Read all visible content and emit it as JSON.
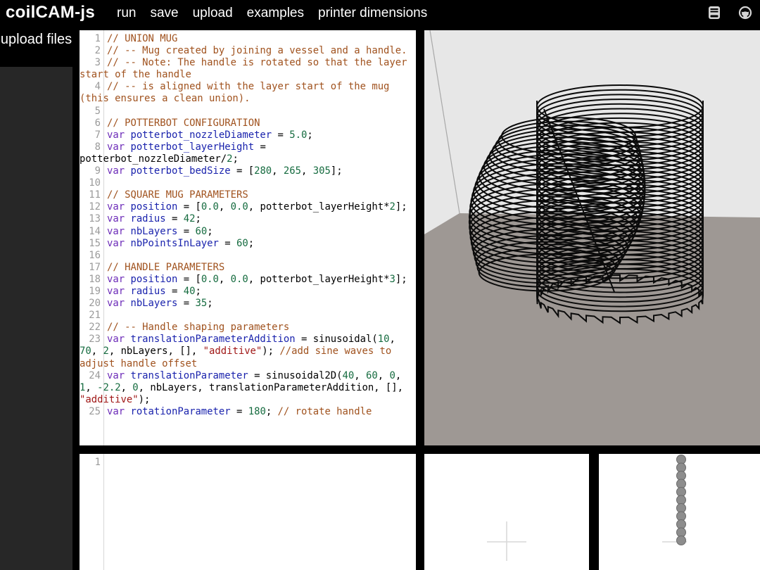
{
  "app": {
    "title": "coilCAM-js"
  },
  "nav": {
    "items": [
      "run",
      "save",
      "upload",
      "examples",
      "printer dimensions"
    ]
  },
  "icons": {
    "docs": "book-icon",
    "github": "github-icon"
  },
  "sidebar": {
    "upload_label": "upload files"
  },
  "editor": {
    "lines": [
      {
        "n": "1",
        "segs": [
          {
            "t": "// UNION MUG",
            "c": "cm"
          }
        ]
      },
      {
        "n": "2",
        "segs": [
          {
            "t": "// -- Mug created by joining a vessel and a handle.",
            "c": "cm"
          }
        ]
      },
      {
        "n": "3",
        "segs": [
          {
            "t": "// -- Note: The handle is rotated so that the layer start of the handle",
            "c": "cm"
          }
        ]
      },
      {
        "n": "4",
        "segs": [
          {
            "t": "// -- is aligned with the layer start of the mug (this ensures a clean union).",
            "c": "cm"
          }
        ]
      },
      {
        "n": "5",
        "segs": []
      },
      {
        "n": "6",
        "segs": [
          {
            "t": "// POTTERBOT CONFIGURATION",
            "c": "cm"
          }
        ]
      },
      {
        "n": "7",
        "segs": [
          {
            "t": "var ",
            "c": "kw"
          },
          {
            "t": "potterbot_nozzleDiameter",
            "c": "vn"
          },
          {
            "t": " = ",
            "c": ""
          },
          {
            "t": "5.0",
            "c": "nm"
          },
          {
            "t": ";",
            "c": ""
          }
        ]
      },
      {
        "n": "8",
        "segs": [
          {
            "t": "var ",
            "c": "kw"
          },
          {
            "t": "potterbot_layerHeight",
            "c": "vn"
          },
          {
            "t": " = potterbot_nozzleDiameter/",
            "c": ""
          },
          {
            "t": "2",
            "c": "nm"
          },
          {
            "t": ";",
            "c": ""
          }
        ]
      },
      {
        "n": "9",
        "segs": [
          {
            "t": "var ",
            "c": "kw"
          },
          {
            "t": "potterbot_bedSize",
            "c": "vn"
          },
          {
            "t": " = [",
            "c": ""
          },
          {
            "t": "280",
            "c": "nm"
          },
          {
            "t": ", ",
            "c": ""
          },
          {
            "t": "265",
            "c": "nm"
          },
          {
            "t": ", ",
            "c": ""
          },
          {
            "t": "305",
            "c": "nm"
          },
          {
            "t": "];",
            "c": ""
          }
        ]
      },
      {
        "n": "10",
        "segs": []
      },
      {
        "n": "11",
        "segs": [
          {
            "t": "// SQUARE MUG PARAMETERS",
            "c": "cm"
          }
        ]
      },
      {
        "n": "12",
        "segs": [
          {
            "t": "var ",
            "c": "kw"
          },
          {
            "t": "position",
            "c": "vn"
          },
          {
            "t": " = [",
            "c": ""
          },
          {
            "t": "0.0",
            "c": "nm"
          },
          {
            "t": ", ",
            "c": ""
          },
          {
            "t": "0.0",
            "c": "nm"
          },
          {
            "t": ", potterbot_layerHeight*",
            "c": ""
          },
          {
            "t": "2",
            "c": "nm"
          },
          {
            "t": "];",
            "c": ""
          }
        ]
      },
      {
        "n": "13",
        "segs": [
          {
            "t": "var ",
            "c": "kw"
          },
          {
            "t": "radius",
            "c": "vn"
          },
          {
            "t": " = ",
            "c": ""
          },
          {
            "t": "42",
            "c": "nm"
          },
          {
            "t": ";",
            "c": ""
          }
        ]
      },
      {
        "n": "14",
        "segs": [
          {
            "t": "var ",
            "c": "kw"
          },
          {
            "t": "nbLayers",
            "c": "vn"
          },
          {
            "t": " = ",
            "c": ""
          },
          {
            "t": "60",
            "c": "nm"
          },
          {
            "t": ";",
            "c": ""
          }
        ]
      },
      {
        "n": "15",
        "segs": [
          {
            "t": "var ",
            "c": "kw"
          },
          {
            "t": "nbPointsInLayer",
            "c": "vn"
          },
          {
            "t": " = ",
            "c": ""
          },
          {
            "t": "60",
            "c": "nm"
          },
          {
            "t": ";",
            "c": ""
          }
        ]
      },
      {
        "n": "16",
        "segs": []
      },
      {
        "n": "17",
        "segs": [
          {
            "t": "// HANDLE PARAMETERS",
            "c": "cm"
          }
        ]
      },
      {
        "n": "18",
        "segs": [
          {
            "t": "var ",
            "c": "kw"
          },
          {
            "t": "position",
            "c": "vn"
          },
          {
            "t": " = [",
            "c": ""
          },
          {
            "t": "0.0",
            "c": "nm"
          },
          {
            "t": ", ",
            "c": ""
          },
          {
            "t": "0.0",
            "c": "nm"
          },
          {
            "t": ", potterbot_layerHeight*",
            "c": ""
          },
          {
            "t": "3",
            "c": "nm"
          },
          {
            "t": "];",
            "c": ""
          }
        ]
      },
      {
        "n": "19",
        "segs": [
          {
            "t": "var ",
            "c": "kw"
          },
          {
            "t": "radius",
            "c": "vn"
          },
          {
            "t": " = ",
            "c": ""
          },
          {
            "t": "40",
            "c": "nm"
          },
          {
            "t": ";",
            "c": ""
          }
        ]
      },
      {
        "n": "20",
        "segs": [
          {
            "t": "var ",
            "c": "kw"
          },
          {
            "t": "nbLayers",
            "c": "vn"
          },
          {
            "t": " = ",
            "c": ""
          },
          {
            "t": "35",
            "c": "nm"
          },
          {
            "t": ";",
            "c": ""
          }
        ]
      },
      {
        "n": "21",
        "segs": []
      },
      {
        "n": "22",
        "segs": [
          {
            "t": "// -- Handle shaping parameters",
            "c": "cm"
          }
        ]
      },
      {
        "n": "23",
        "segs": [
          {
            "t": "var ",
            "c": "kw"
          },
          {
            "t": "translationParameterAddition",
            "c": "vn"
          },
          {
            "t": " = sinusoidal(",
            "c": ""
          },
          {
            "t": "10",
            "c": "nm"
          },
          {
            "t": ", ",
            "c": ""
          },
          {
            "t": "70",
            "c": "nm"
          },
          {
            "t": ", ",
            "c": ""
          },
          {
            "t": "2",
            "c": "nm"
          },
          {
            "t": ", nbLayers, [], ",
            "c": ""
          },
          {
            "t": "\"additive\"",
            "c": "st"
          },
          {
            "t": "); ",
            "c": ""
          },
          {
            "t": "//add sine waves to adjust handle offset",
            "c": "cm"
          }
        ]
      },
      {
        "n": "24",
        "segs": [
          {
            "t": "var ",
            "c": "kw"
          },
          {
            "t": "translationParameter",
            "c": "vn"
          },
          {
            "t": " = sinusoidal2D(",
            "c": ""
          },
          {
            "t": "40",
            "c": "nm"
          },
          {
            "t": ", ",
            "c": ""
          },
          {
            "t": "60",
            "c": "nm"
          },
          {
            "t": ", ",
            "c": ""
          },
          {
            "t": "0",
            "c": "nm"
          },
          {
            "t": ", ",
            "c": ""
          },
          {
            "t": "1",
            "c": "nm"
          },
          {
            "t": ", ",
            "c": ""
          },
          {
            "t": "-2.2",
            "c": "nm"
          },
          {
            "t": ", ",
            "c": ""
          },
          {
            "t": "0",
            "c": "nm"
          },
          {
            "t": ", nbLayers, translationParameterAddition, [], ",
            "c": ""
          },
          {
            "t": "\"additive\"",
            "c": "st"
          },
          {
            "t": ");",
            "c": ""
          }
        ]
      },
      {
        "n": "25",
        "segs": [
          {
            "t": "var ",
            "c": "kw"
          },
          {
            "t": "rotationParameter",
            "c": "vn"
          },
          {
            "t": " = ",
            "c": ""
          },
          {
            "t": "180",
            "c": "nm"
          },
          {
            "t": "; ",
            "c": ""
          },
          {
            "t": "// rotate handle",
            "c": "cm"
          }
        ]
      }
    ]
  },
  "bottom_editor": {
    "line_number": "1"
  },
  "colors": {
    "comment": "#a0521e",
    "keyword": "#6c2bb8",
    "variable": "#1a23ad",
    "number": "#156b3f",
    "string": "#a01817",
    "viewport_background": "#e7e7e7",
    "floor": "#9e9894"
  }
}
